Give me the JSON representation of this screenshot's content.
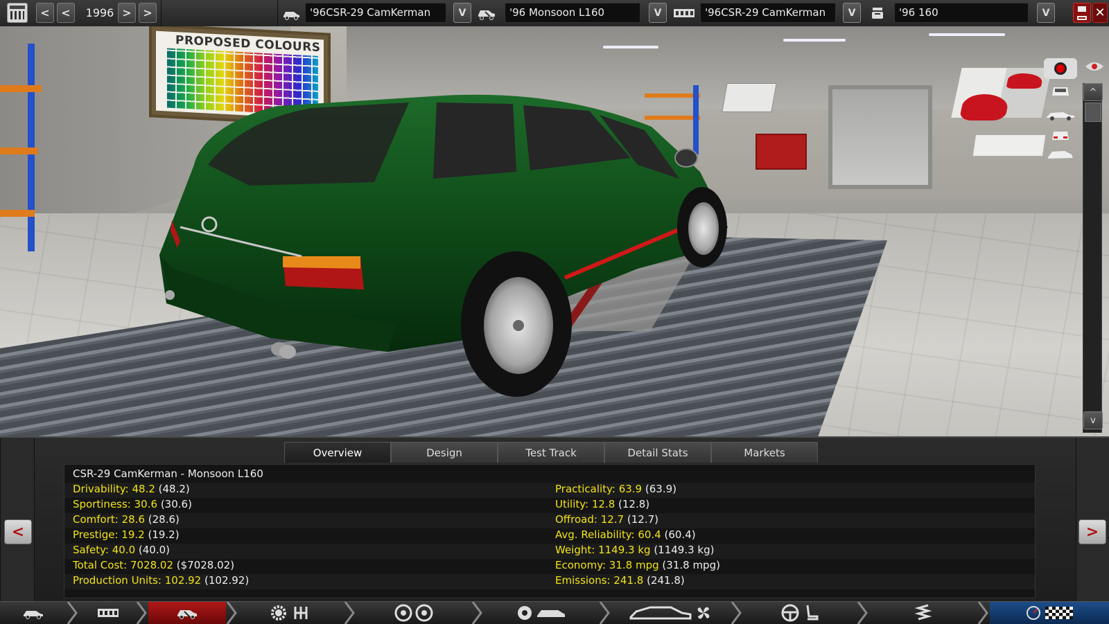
{
  "toolbar": {
    "year": "1996",
    "nav_arrows": {
      "prev": "<",
      "next": ">"
    },
    "selectors": [
      {
        "name": "car-model",
        "value": "'96CSR-29 CamKerman"
      },
      {
        "name": "trim",
        "value": "'96   Monsoon L160"
      },
      {
        "name": "engine-family",
        "value": "'96CSR-29 CamKerman"
      },
      {
        "name": "engine-variant",
        "value": "'96                160"
      }
    ],
    "dropdown_glyph": "V",
    "close_glyph": "✕"
  },
  "scene": {
    "poster_title": "PROPOSED COLOURS",
    "car_color": "#0f4a18",
    "scroll_up": "^",
    "scroll_down": "v"
  },
  "panel": {
    "tabs": [
      "Overview",
      "Design",
      "Test Track",
      "Detail Stats",
      "Markets"
    ],
    "active_tab": "Overview",
    "side_prev": "<",
    "side_next": ">",
    "title": "CSR-29 CamKerman - Monsoon L160",
    "left_stats": [
      {
        "label": "Drivability: 48.2",
        "value": "(48.2)"
      },
      {
        "label": "Sportiness: 30.6",
        "value": "(30.6)"
      },
      {
        "label": "Comfort: 28.6",
        "value": "(28.6)"
      },
      {
        "label": "Prestige: 19.2",
        "value": "(19.2)"
      },
      {
        "label": "Safety: 40.0",
        "value": "(40.0)"
      },
      {
        "label": "Total Cost: 7028.02",
        "value": "($7028.02)"
      },
      {
        "label": "Production Units: 102.92",
        "value": "(102.92)"
      }
    ],
    "right_stats": [
      {
        "label": "Practicality: 63.9",
        "value": "(63.9)"
      },
      {
        "label": "Utility: 12.8",
        "value": "(12.8)"
      },
      {
        "label": "Offroad: 12.7",
        "value": "(12.7)"
      },
      {
        "label": "Avg. Reliability: 60.4",
        "value": "(60.4)"
      },
      {
        "label": "Weight: 1149.3 kg",
        "value": "(1149.3 kg)"
      },
      {
        "label": "Economy: 31.8 mpg",
        "value": "(31.8 mpg)"
      },
      {
        "label": "Emissions: 241.8",
        "value": "(241.8)"
      }
    ]
  },
  "bottom_nav": [
    {
      "name": "car-model-step",
      "icons": [
        "car-model-icon"
      ]
    },
    {
      "name": "engine-step",
      "icons": [
        "engine-block-icon"
      ]
    },
    {
      "name": "trim-step",
      "icons": [
        "trim-car-icon"
      ],
      "active": true
    },
    {
      "name": "drivetrain-step",
      "icons": [
        "gear-icon",
        "gearbox-icon"
      ]
    },
    {
      "name": "suspension-step",
      "icons": [
        "wheel-icon",
        "wheel-icon"
      ]
    },
    {
      "name": "tires-step",
      "icons": [
        "tire-icon",
        "body-icon"
      ]
    },
    {
      "name": "aero-step",
      "icons": [
        "car-silhouette-icon",
        "fan-icon"
      ]
    },
    {
      "name": "interior-step",
      "icons": [
        "steering-wheel-icon",
        "seat-icon"
      ]
    },
    {
      "name": "safety-step",
      "icons": [
        "spring-icon"
      ]
    },
    {
      "name": "testing-step",
      "icons": [
        "speedometer-icon",
        "checkered-flag-icon"
      ]
    }
  ],
  "colors": {
    "stat_label": "#f2e31a",
    "stat_value": "#eeeeee",
    "active_nav": "#b01818",
    "accent_blue": "#1c4e8a"
  }
}
